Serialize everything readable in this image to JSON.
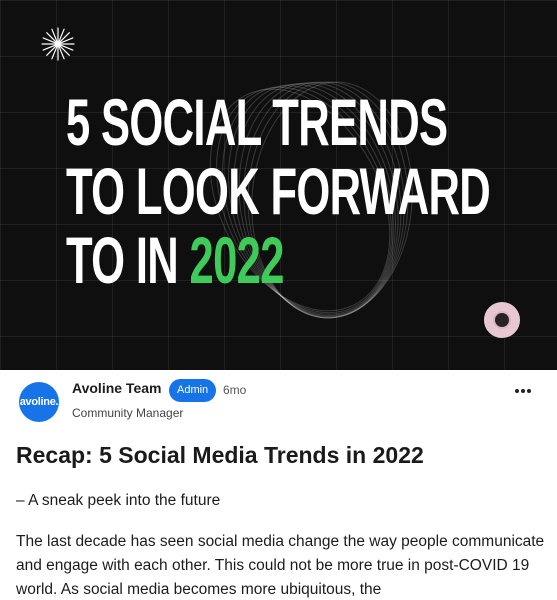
{
  "hero": {
    "title_line1": "5 SOCIAL TRENDS",
    "title_line2": "TO LOOK FORWARD",
    "title_line3_prefix": "TO IN ",
    "title_line3_accent": "2022",
    "accent_color": "#3fcb5a",
    "background_color": "#0f0f10",
    "icons": [
      "burst-icon",
      "ring-icon"
    ]
  },
  "post": {
    "avatar_text": "avoline.",
    "author": "Avoline Team",
    "badge": "Admin",
    "time": "6mo",
    "role": "Community Manager",
    "title": "Recap: 5 Social Media Trends in 2022",
    "subtitle": "– A sneak peek into the future",
    "body": "The last decade has seen social media change the way people communicate and engage with each other. This could not be more true in post-COVID 19 world. As social media becomes more ubiquitous, the",
    "accent_color": "#1674e8",
    "more_icon": "more-horizontal-icon"
  }
}
